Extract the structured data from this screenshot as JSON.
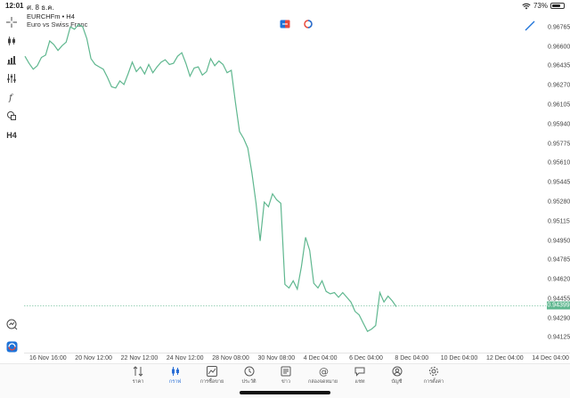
{
  "status_bar": {
    "time": "12:01",
    "date": "ศ. 8 ธ.ค.",
    "battery_text": "73%",
    "battery_level": 0.73
  },
  "chart_header": {
    "symbol_line": "EURCHFm • H4",
    "description": "Euro vs Swiss Franc"
  },
  "left_toolbar": {
    "items": [
      "crosshair-icon",
      "candlestick-icon",
      "bar-chart-icon",
      "indicators-icon",
      "function-icon",
      "shapes-icon"
    ],
    "timeframe": "H4",
    "bottom_items": [
      "zoom-icon",
      "trade-icon"
    ]
  },
  "chart_data": {
    "type": "line",
    "series_color": "#5fb78f",
    "current_price": 0.94399,
    "current_price_label": "0.94399",
    "ylim": [
      0.94,
      0.969
    ],
    "y_ticks": [
      "0.96765",
      "0.96600",
      "0.96435",
      "0.96270",
      "0.96105",
      "0.95940",
      "0.95775",
      "0.95610",
      "0.95445",
      "0.95280",
      "0.95115",
      "0.94950",
      "0.94785",
      "0.94620",
      "0.94455",
      "0.94290",
      "0.94125"
    ],
    "x_ticks": [
      "16 Nov 16:00",
      "20 Nov 12:00",
      "22 Nov 12:00",
      "24 Nov 12:00",
      "28 Nov 08:00",
      "30 Nov 08:00",
      "4 Dec 04:00",
      "6 Dec 04:00",
      "8 Dec 04:00",
      "10 Dec 04:00",
      "12 Dec 04:00",
      "14 Dec 04:00"
    ],
    "values": [
      0.9652,
      0.9646,
      0.9641,
      0.9644,
      0.9651,
      0.9653,
      0.9665,
      0.9662,
      0.9657,
      0.9661,
      0.9664,
      0.9677,
      0.9675,
      0.9679,
      0.9677,
      0.9667,
      0.965,
      0.9645,
      0.9643,
      0.9641,
      0.9634,
      0.9626,
      0.9625,
      0.9631,
      0.9628,
      0.9637,
      0.9647,
      0.9639,
      0.9643,
      0.9637,
      0.9645,
      0.9638,
      0.9643,
      0.9647,
      0.9649,
      0.9645,
      0.9646,
      0.9652,
      0.9655,
      0.9646,
      0.9635,
      0.9642,
      0.9643,
      0.9636,
      0.9639,
      0.965,
      0.9644,
      0.9648,
      0.9645,
      0.9638,
      0.964,
      0.9613,
      0.9588,
      0.9582,
      0.9574,
      0.9553,
      0.9527,
      0.9495,
      0.9528,
      0.9524,
      0.9535,
      0.953,
      0.9527,
      0.9458,
      0.9455,
      0.9461,
      0.9454,
      0.9473,
      0.9498,
      0.9487,
      0.9459,
      0.9455,
      0.9461,
      0.9452,
      0.945,
      0.9451,
      0.9447,
      0.9451,
      0.9447,
      0.9443,
      0.9435,
      0.9432,
      0.9425,
      0.9418,
      0.942,
      0.9423,
      0.9451,
      0.9443,
      0.9448,
      0.9444,
      0.9439
    ]
  },
  "top_icons": [
    "buy-sell-icon",
    "one-click-icon"
  ],
  "drawing_tool_icon": "trendline-icon",
  "bottom_nav": {
    "items": [
      {
        "id": "quotes",
        "label": "ราคา",
        "icon": "arrows-icon"
      },
      {
        "id": "chart",
        "label": "กราฟ",
        "icon": "chart-icon",
        "active": true
      },
      {
        "id": "trade",
        "label": "การซื้อขาย",
        "icon": "trade-line-icon"
      },
      {
        "id": "history",
        "label": "ประวัติ",
        "icon": "history-icon"
      },
      {
        "id": "news",
        "label": "ข่าว",
        "icon": "news-icon"
      },
      {
        "id": "mailbox",
        "label": "กล่องจดหมาย",
        "icon": "mail-icon"
      },
      {
        "id": "chat",
        "label": "แชท",
        "icon": "chat-icon"
      },
      {
        "id": "account",
        "label": "บัญชี",
        "icon": "account-icon"
      },
      {
        "id": "settings",
        "label": "การตั้งค่า",
        "icon": "settings-icon"
      }
    ]
  }
}
